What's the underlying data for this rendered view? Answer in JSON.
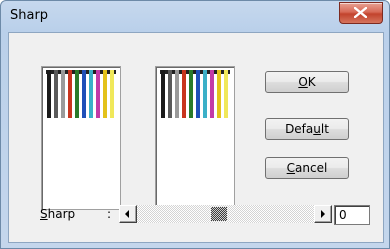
{
  "window": {
    "title": "Sharp"
  },
  "buttons": {
    "ok_mnemonic": "O",
    "ok_rest": "K",
    "default_pre": "Defa",
    "default_mnemonic": "u",
    "default_post": "lt",
    "cancel_mnemonic": "C",
    "cancel_rest": "ancel"
  },
  "sharp": {
    "label_mnemonic": "S",
    "label_rest": "harp",
    "colon": ":",
    "value": "0",
    "slider_level": 0.46
  },
  "preview": {
    "stripe_colors": [
      "#1a1a1a",
      "#5a5a5a",
      "#9a9a9a",
      "#c8351e",
      "#2a7a2a",
      "#1f4fb8",
      "#3bb0c8",
      "#c23aa8",
      "#e3c21a",
      "#f0e85a"
    ]
  }
}
